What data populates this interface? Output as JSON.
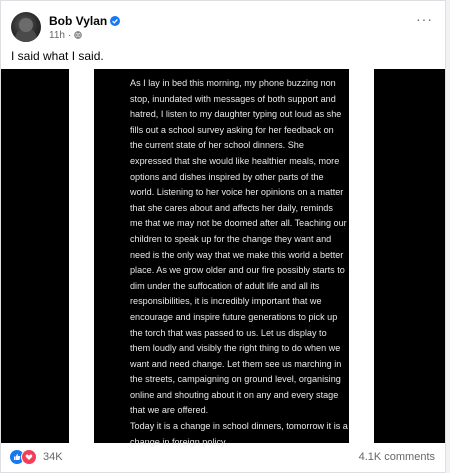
{
  "post": {
    "author": "Bob Vylan",
    "time": "11h",
    "separator": "·",
    "text": "I said what I said.",
    "more": "···"
  },
  "statement": {
    "paragraph1": "As I lay in bed this morning, my phone buzzing non stop, inundated with messages of both support and hatred, I listen to my daughter typing out loud as she fills out a school survey asking for her feedback on the current state of her school dinners. She expressed that she would like healthier meals, more options and dishes inspired by other parts of the world. Listening to her voice her opinions on a matter that she cares about and affects her daily, reminds me that we may not be doomed after all. Teaching our children to speak up for the change they want and need is the only way that we make this world a better place. As we grow older and our fire possibly starts to dim under the suffocation of adult life and all its responsibilities, it is incredibly important that we encourage and inspire future generations to pick up the torch that was passed to us. Let us display to them loudly and visibly the right thing to do when we want and need change. Let them see us marching in the streets, campaigning on ground level, organising online and shouting about it on any and every stage that we are offered.",
    "paragraph2": "Today it is a change in school dinners, tomorrow it is a change in foreign policy."
  },
  "footer": {
    "reaction_count": "34K",
    "comments": "4.1K comments"
  },
  "colors": {
    "accent": "#1877f2",
    "love": "#f33e58",
    "image_bg": "#000000"
  },
  "icons": [
    "verified-badge-icon",
    "globe-icon",
    "like-reaction-icon",
    "love-reaction-icon",
    "more-options-icon"
  ]
}
